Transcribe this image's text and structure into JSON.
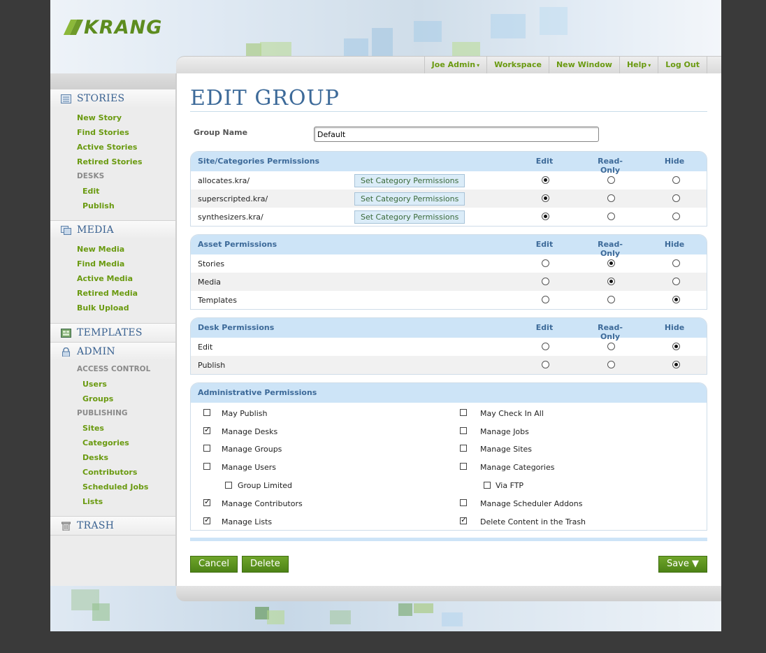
{
  "app": {
    "logo_text": "KRANG"
  },
  "nav": {
    "items": [
      {
        "label": "Joe Admin",
        "caret": "▾"
      },
      {
        "label": "Workspace"
      },
      {
        "label": "New Window"
      },
      {
        "label": "Help",
        "caret": "▾"
      },
      {
        "label": "Log Out"
      }
    ]
  },
  "sidebar": {
    "stories": {
      "title": "STORIES",
      "icon": "stories-icon",
      "items": [
        "New Story",
        "Find Stories",
        "Active Stories",
        "Retired Stories"
      ],
      "desks_label": "DESKS",
      "desks": [
        "Edit",
        "Publish"
      ]
    },
    "media": {
      "title": "MEDIA",
      "icon": "media-icon",
      "items": [
        "New Media",
        "Find Media",
        "Active Media",
        "Retired Media",
        "Bulk Upload"
      ]
    },
    "templates": {
      "title": "TEMPLATES",
      "icon": "templates-icon"
    },
    "admin": {
      "title": "ADMIN",
      "icon": "lock-icon",
      "access_label": "ACCESS CONTROL",
      "access": [
        "Users",
        "Groups"
      ],
      "publishing_label": "PUBLISHING",
      "publishing": [
        "Sites",
        "Categories",
        "Desks",
        "Contributors",
        "Scheduled Jobs",
        "Lists"
      ]
    },
    "trash": {
      "title": "TRASH",
      "icon": "trash-icon"
    }
  },
  "main": {
    "title": "EDIT GROUP",
    "group_name_label": "Group Name",
    "group_name_value": "Default",
    "columns": {
      "edit": "Edit",
      "read_only": "Read-Only",
      "hide": "Hide"
    },
    "site_perms": {
      "title": "Site/Categories Permissions",
      "button_label": "Set Category Permissions",
      "rows": [
        {
          "label": "allocates.kra/",
          "selected": "edit"
        },
        {
          "label": "superscripted.kra/",
          "selected": "edit"
        },
        {
          "label": "synthesizers.kra/",
          "selected": "edit"
        }
      ]
    },
    "asset_perms": {
      "title": "Asset Permissions",
      "rows": [
        {
          "label": "Stories",
          "selected": "read_only"
        },
        {
          "label": "Media",
          "selected": "read_only"
        },
        {
          "label": "Templates",
          "selected": "hide"
        }
      ]
    },
    "desk_perms": {
      "title": "Desk Permissions",
      "rows": [
        {
          "label": "Edit",
          "selected": "hide"
        },
        {
          "label": "Publish",
          "selected": "hide"
        }
      ]
    },
    "admin_perms": {
      "title": "Administrative Permissions",
      "left": [
        {
          "label": "May Publish",
          "checked": false
        },
        {
          "label": "Manage Desks",
          "checked": true
        },
        {
          "label": "Manage Groups",
          "checked": false
        },
        {
          "label": "Manage Users",
          "checked": false
        },
        {
          "label": "Group Limited",
          "checked": false,
          "indent": true
        },
        {
          "label": "Manage Contributors",
          "checked": true
        },
        {
          "label": "Manage Lists",
          "checked": true
        }
      ],
      "right": [
        {
          "label": "May Check In All",
          "checked": false
        },
        {
          "label": "Manage Jobs",
          "checked": false
        },
        {
          "label": "Manage Sites",
          "checked": false
        },
        {
          "label": "Manage Categories",
          "checked": false
        },
        {
          "label": "Via FTP",
          "checked": false,
          "indent": true
        },
        {
          "label": "Manage Scheduler Addons",
          "checked": false
        },
        {
          "label": "Delete Content in the Trash",
          "checked": true
        }
      ]
    },
    "buttons": {
      "cancel": "Cancel",
      "delete": "Delete",
      "save": "Save ▼"
    }
  },
  "colors": {
    "accent_green": "#6a9a10",
    "heading_blue": "#3d6a99",
    "panel_blue": "#cde4f7"
  }
}
